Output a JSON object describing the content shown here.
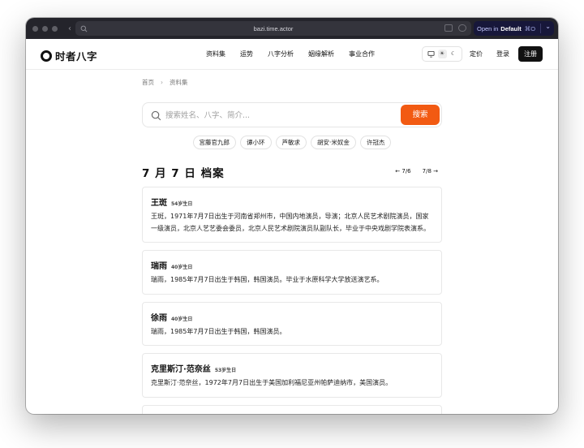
{
  "browser": {
    "url": "bazi.time.actor",
    "open_in_label": "Open in",
    "open_in_target": "Default",
    "open_in_shortcut": "⌘O"
  },
  "header": {
    "logo_text": "时者八字",
    "nav": [
      "资料集",
      "运势",
      "八字分析",
      "姻缘解析",
      "事业合作"
    ],
    "pricing": "定价",
    "login": "登录",
    "signup": "注册"
  },
  "breadcrumb": {
    "home": "首页",
    "separator": "›",
    "current": "资料集"
  },
  "search": {
    "placeholder": "搜索姓名、八字、简介...",
    "button": "搜索"
  },
  "chips": [
    "宫藤官九郎",
    "谭小环",
    "芦敏求",
    "胡安·米奴金",
    "许冠杰"
  ],
  "page": {
    "title": "7 月 7 日 档案",
    "prev": "← 7/6",
    "next": "7/8 →"
  },
  "profiles": [
    {
      "name": "王斑",
      "age": "54岁生日",
      "bio": "王斑，1971年7月7日出生于河南省郑州市，中国内地演员，导演；北京人民艺术剧院演员，国家一级演员，北京人艺艺委会委员，北京人民艺术剧院演员队副队长，毕业于中央戏剧学院表演系。"
    },
    {
      "name": "瑞雨",
      "age": "40岁生日",
      "bio": "瑞雨，1985年7月7日出生于韩国，韩国演员。毕业于水原科学大学放送演艺系。"
    },
    {
      "name": "徐雨",
      "age": "40岁生日",
      "bio": "瑞雨，1985年7月7日出生于韩国，韩国演员。"
    },
    {
      "name": "克里斯汀·范奈丝",
      "age": "53岁生日",
      "bio": "克里斯汀·范奈丝，1972年7月7日出生于美国加利福尼亚州帕萨迪纳市，美国演员。"
    }
  ]
}
